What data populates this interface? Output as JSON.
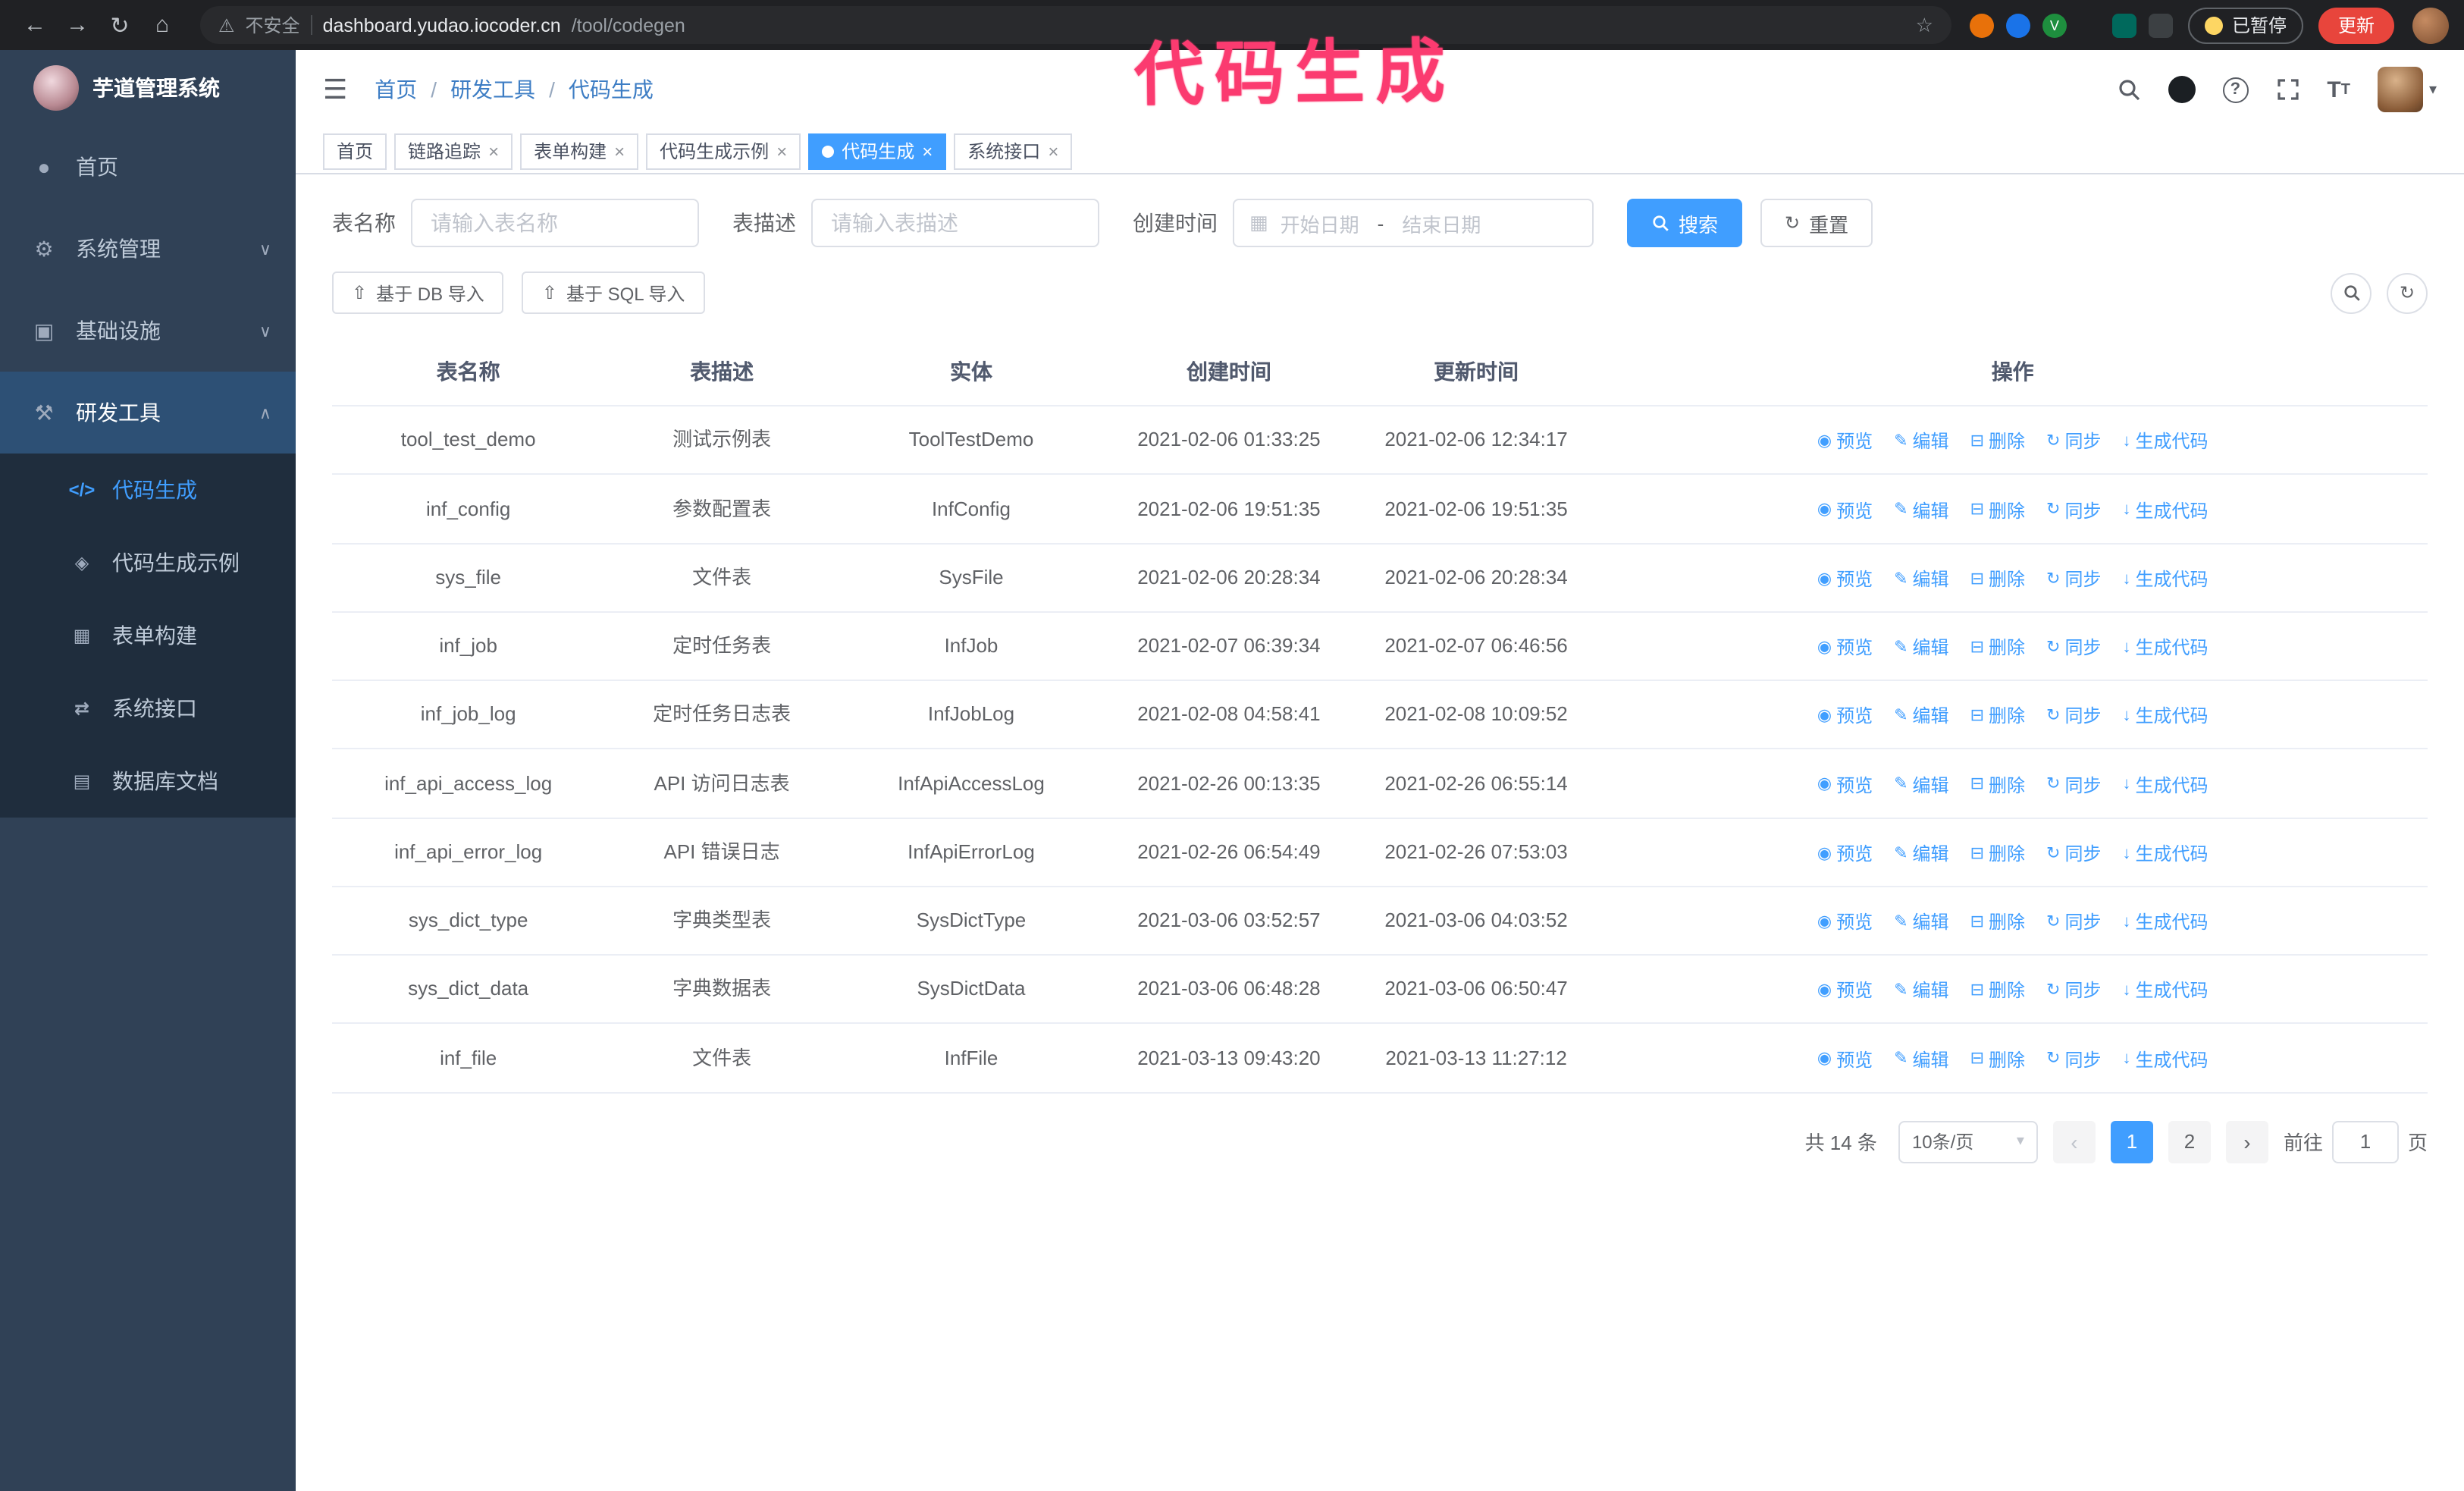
{
  "colors": {
    "accent": "#409eff",
    "sidebar_bg": "#304156",
    "submenu_bg": "#1f2d3d",
    "active_parent_bg": "#2d5075",
    "annotation": "#fb3b70",
    "update_button": "#e8453c",
    "chrome_bg": "#202124"
  },
  "annotation": {
    "text": "代码生成"
  },
  "browser": {
    "security_label": "不安全",
    "url_host": "dashboard.yudao.iocoder.cn",
    "url_path": "/tool/codegen",
    "paused_label": "已暂停",
    "update_label": "更新"
  },
  "sidebar": {
    "logo_title": "芋道管理系统",
    "items": [
      {
        "label": "首页"
      },
      {
        "label": "系统管理"
      },
      {
        "label": "基础设施"
      },
      {
        "label": "研发工具"
      }
    ],
    "submenu": [
      {
        "label": "代码生成"
      },
      {
        "label": "代码生成示例"
      },
      {
        "label": "表单构建"
      },
      {
        "label": "系统接口"
      },
      {
        "label": "数据库文档"
      }
    ]
  },
  "breadcrumb": [
    "首页",
    "研发工具",
    "代码生成"
  ],
  "tabs": [
    {
      "label": "首页",
      "closable": false,
      "active": false
    },
    {
      "label": "链路追踪",
      "closable": true,
      "active": false
    },
    {
      "label": "表单构建",
      "closable": true,
      "active": false
    },
    {
      "label": "代码生成示例",
      "closable": true,
      "active": false
    },
    {
      "label": "代码生成",
      "closable": true,
      "active": true
    },
    {
      "label": "系统接口",
      "closable": true,
      "active": false
    }
  ],
  "filters": {
    "table_name_label": "表名称",
    "table_name_placeholder": "请输入表名称",
    "table_desc_label": "表描述",
    "table_desc_placeholder": "请输入表描述",
    "create_time_label": "创建时间",
    "start_date_placeholder": "开始日期",
    "date_separator": "-",
    "end_date_placeholder": "结束日期",
    "search_label": "搜索",
    "reset_label": "重置"
  },
  "toolbar": {
    "import_db": "基于 DB 导入",
    "import_sql": "基于 SQL 导入"
  },
  "table": {
    "columns": [
      "表名称",
      "表描述",
      "实体",
      "创建时间",
      "更新时间",
      "操作"
    ],
    "ops": [
      {
        "name": "preview",
        "icon": "◉",
        "label": "预览"
      },
      {
        "name": "edit",
        "icon": "✎",
        "label": "编辑"
      },
      {
        "name": "delete",
        "icon": "⊟",
        "label": "删除"
      },
      {
        "name": "sync",
        "icon": "↻",
        "label": "同步"
      },
      {
        "name": "generate-code",
        "icon": "↓",
        "label": "生成代码"
      }
    ],
    "rows": [
      {
        "name": "tool_test_demo",
        "desc": "测试示例表",
        "entity": "ToolTestDemo",
        "created": "2021-02-06 01:33:25",
        "updated": "2021-02-06 12:34:17"
      },
      {
        "name": "inf_config",
        "desc": "参数配置表",
        "entity": "InfConfig",
        "created": "2021-02-06 19:51:35",
        "updated": "2021-02-06 19:51:35"
      },
      {
        "name": "sys_file",
        "desc": "文件表",
        "entity": "SysFile",
        "created": "2021-02-06 20:28:34",
        "updated": "2021-02-06 20:28:34"
      },
      {
        "name": "inf_job",
        "desc": "定时任务表",
        "entity": "InfJob",
        "created": "2021-02-07 06:39:34",
        "updated": "2021-02-07 06:46:56"
      },
      {
        "name": "inf_job_log",
        "desc": "定时任务日志表",
        "entity": "InfJobLog",
        "created": "2021-02-08 04:58:41",
        "updated": "2021-02-08 10:09:52"
      },
      {
        "name": "inf_api_access_log",
        "desc": "API 访问日志表",
        "entity": "InfApiAccessLog",
        "created": "2021-02-26 00:13:35",
        "updated": "2021-02-26 06:55:14"
      },
      {
        "name": "inf_api_error_log",
        "desc": "API 错误日志",
        "entity": "InfApiErrorLog",
        "created": "2021-02-26 06:54:49",
        "updated": "2021-02-26 07:53:03"
      },
      {
        "name": "sys_dict_type",
        "desc": "字典类型表",
        "entity": "SysDictType",
        "created": "2021-03-06 03:52:57",
        "updated": "2021-03-06 04:03:52"
      },
      {
        "name": "sys_dict_data",
        "desc": "字典数据表",
        "entity": "SysDictData",
        "created": "2021-03-06 06:48:28",
        "updated": "2021-03-06 06:50:47"
      },
      {
        "name": "inf_file",
        "desc": "文件表",
        "entity": "InfFile",
        "created": "2021-03-13 09:43:20",
        "updated": "2021-03-13 11:27:12"
      }
    ]
  },
  "pagination": {
    "total_text": "共 14 条",
    "page_size": "10条/页",
    "pages": [
      "1",
      "2"
    ],
    "current_page": "1",
    "goto_label": "前往",
    "goto_value": "1",
    "goto_suffix": "页"
  }
}
